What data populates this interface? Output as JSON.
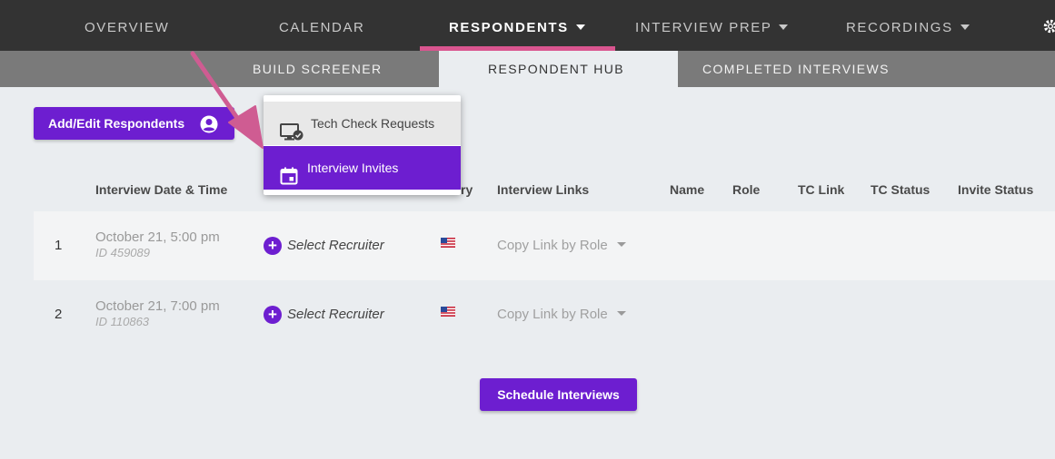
{
  "topnav": {
    "items": [
      {
        "label": "OVERVIEW",
        "dropdown": false
      },
      {
        "label": "CALENDAR",
        "dropdown": false
      },
      {
        "label": "RESPONDENTS",
        "dropdown": true,
        "active": true
      },
      {
        "label": "INTERVIEW PREP",
        "dropdown": true
      },
      {
        "label": "RECORDINGS",
        "dropdown": true
      }
    ],
    "settings_icon": "gear-icon"
  },
  "subnav": {
    "items": [
      {
        "label": "BUILD SCREENER"
      },
      {
        "label": "RESPONDENT HUB",
        "active": true
      },
      {
        "label": "COMPLETED INTERVIEWS"
      }
    ]
  },
  "toolbar": {
    "add_edit_label": "Add/Edit Respondents",
    "add_edit_icon": "user-circle-icon"
  },
  "dropdown": {
    "items": [
      {
        "label": "Tech Check Requests",
        "icon": "monitor-check-icon"
      },
      {
        "label": "Interview Invites",
        "icon": "calendar-icon",
        "selected": true
      }
    ]
  },
  "table": {
    "headers": {
      "date": "Interview Date & Time",
      "country_partial": "ry",
      "links": "Interview Links",
      "name": "Name",
      "role": "Role",
      "tc_link": "TC Link",
      "tc_status": "TC Status",
      "invite_status": "Invite Status"
    },
    "rows": [
      {
        "num": "1",
        "date": "October 21, 5:00 pm",
        "id": "ID 459089",
        "recruiter": "Select Recruiter",
        "flag": "us-flag-icon",
        "copy_link": "Copy Link by Role"
      },
      {
        "num": "2",
        "date": "October 21, 7:00 pm",
        "id": "ID 110863",
        "recruiter": "Select Recruiter",
        "flag": "us-flag-icon",
        "copy_link": "Copy Link by Role"
      }
    ]
  },
  "footer": {
    "schedule_label": "Schedule Interviews"
  },
  "colors": {
    "accent": "#6d1ed0",
    "nav_bg": "#333333",
    "subnav_bg": "#7a7a7a",
    "highlight": "#d9558f",
    "page_bg": "#eaedf0"
  }
}
